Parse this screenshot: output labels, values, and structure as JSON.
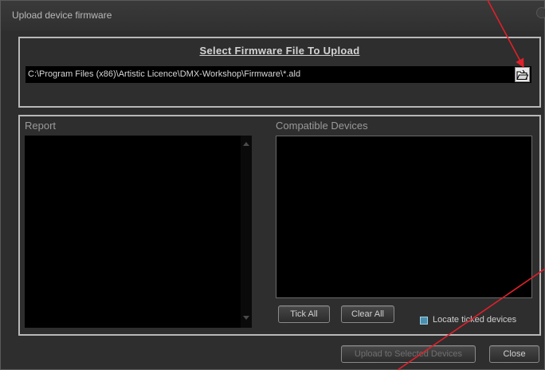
{
  "window": {
    "title": "Upload device firmware"
  },
  "firmware": {
    "section_title": "Select Firmware File To Upload",
    "path": "C:\\Program Files (x86)\\Artistic Licence\\DMX-Workshop\\Firmware\\*.ald"
  },
  "report": {
    "label": "Report"
  },
  "devices": {
    "label": "Compatible Devices",
    "tick_all": "Tick All",
    "clear_all": "Clear All",
    "locate_label": "Locate ticked devices",
    "locate_checked": false
  },
  "footer": {
    "upload_label": "Upload to Selected Devices",
    "close_label": "Close"
  },
  "colors": {
    "annotation_arrow": "#e0202a",
    "checkbox": "#4a8fb0"
  },
  "icons": {
    "browse": "folder-browse-icon"
  }
}
